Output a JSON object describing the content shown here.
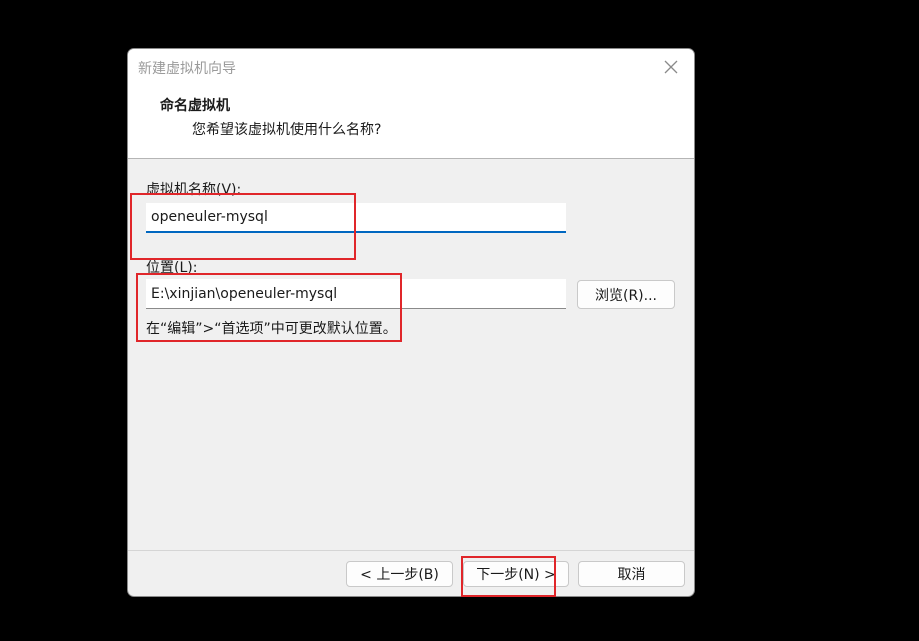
{
  "dialog": {
    "title": "新建虚拟机向导",
    "close_icon": "close-icon"
  },
  "header": {
    "title": "命名虚拟机",
    "subtitle": "您希望该虚拟机使用什么名称?"
  },
  "form": {
    "name_label": "虚拟机名称(V):",
    "name_value": "openeuler-mysql",
    "location_label": "位置(L):",
    "location_value": "E:\\xinjian\\openeuler-mysql",
    "browse_label": "浏览(R)...",
    "hint": "在“编辑”>“首选项”中可更改默认位置。"
  },
  "footer": {
    "back_label": "< 上一步(B)",
    "next_label": "下一步(N) >",
    "cancel_label": "取消"
  },
  "colors": {
    "highlight": "#e0262a",
    "focus_accent": "#0067c0"
  }
}
